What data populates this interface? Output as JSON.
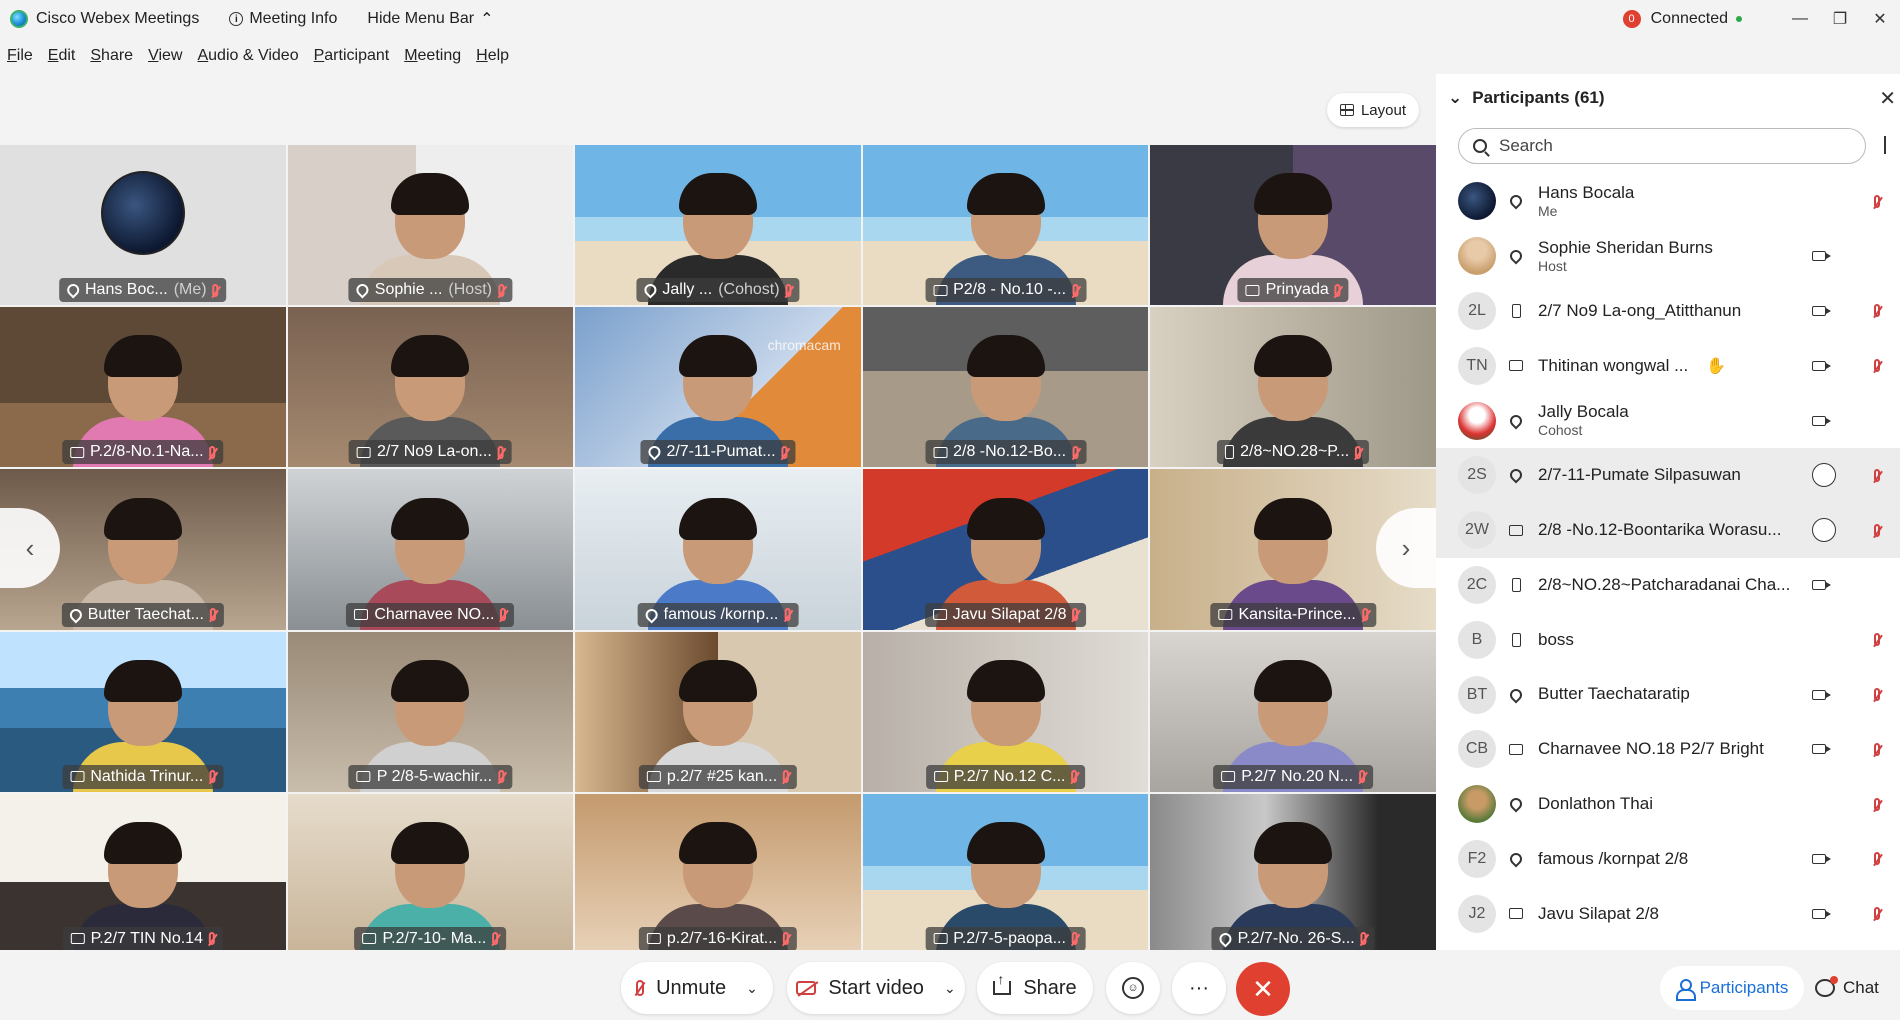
{
  "titlebar": {
    "app_name": "Cisco Webex Meetings",
    "meeting_info": "Meeting Info",
    "hide_menu": "Hide Menu Bar",
    "status": "Connected",
    "status_badge": "0"
  },
  "menu": [
    "File",
    "Edit",
    "Share",
    "View",
    "Audio & Video",
    "Participant",
    "Meeting",
    "Help"
  ],
  "layout_label": "Layout",
  "watermark": "chromacam",
  "tiles": [
    {
      "name": "Hans Boc...",
      "suffix": "(Me)",
      "icon": "audio"
    },
    {
      "name": "Sophie ...",
      "suffix": "(Host)",
      "icon": "audio"
    },
    {
      "name": "Jally ...",
      "suffix": "(Cohost)",
      "icon": "audio"
    },
    {
      "name": "P2/8 - No.10 -...",
      "suffix": "",
      "icon": "screen"
    },
    {
      "name": "Prinyada",
      "suffix": "",
      "icon": "screen"
    },
    {
      "name": "P.2/8-No.1-Na...",
      "suffix": "",
      "icon": "screen"
    },
    {
      "name": "2/7 No9 La-on...",
      "suffix": "",
      "icon": "screen"
    },
    {
      "name": "2/7-11-Pumat...",
      "suffix": "",
      "icon": "audio"
    },
    {
      "name": "2/8 -No.12-Bo...",
      "suffix": "",
      "icon": "screen"
    },
    {
      "name": "2/8~NO.28~P...",
      "suffix": "",
      "icon": "phone"
    },
    {
      "name": "Butter Taechat...",
      "suffix": "",
      "icon": "audio"
    },
    {
      "name": "Charnavee NO...",
      "suffix": "",
      "icon": "screen"
    },
    {
      "name": "famous /kornp...",
      "suffix": "",
      "icon": "audio"
    },
    {
      "name": "Javu Silapat 2/8",
      "suffix": "",
      "icon": "screen"
    },
    {
      "name": "Kansita-Prince...",
      "suffix": "",
      "icon": "screen"
    },
    {
      "name": "Nathida Trinur...",
      "suffix": "",
      "icon": "screen"
    },
    {
      "name": "P 2/8-5-wachir...",
      "suffix": "",
      "icon": "screen"
    },
    {
      "name": "p.2/7 #25 kan...",
      "suffix": "",
      "icon": "screen"
    },
    {
      "name": "P.2/7 No.12 C...",
      "suffix": "",
      "icon": "screen"
    },
    {
      "name": "P.2/7 No.20 N...",
      "suffix": "",
      "icon": "screen"
    },
    {
      "name": "P.2/7 TIN No.14",
      "suffix": "",
      "icon": "screen"
    },
    {
      "name": "P.2/7-10- Ma...",
      "suffix": "",
      "icon": "screen"
    },
    {
      "name": "p.2/7-16-Kirat...",
      "suffix": "",
      "icon": "screen"
    },
    {
      "name": "P.2/7-5-paopa...",
      "suffix": "",
      "icon": "screen"
    },
    {
      "name": "P.2/7-No. 26-S...",
      "suffix": "",
      "icon": "audio"
    }
  ],
  "panel": {
    "title": "Participants (61)",
    "search_placeholder": "Search",
    "participants": [
      {
        "initials": "",
        "name": "Hans Bocala",
        "role": "Me",
        "state": "audio"
      },
      {
        "initials": "",
        "name": "Sophie Sheridan Burns",
        "role": "Host",
        "state": "audio"
      },
      {
        "initials": "2L",
        "name": "2/7 No9 La-ong_Atitthanun",
        "role": "",
        "state": "phone"
      },
      {
        "initials": "TN",
        "name": "Thitinan wongwal ...",
        "role": "",
        "state": "screen"
      },
      {
        "initials": "",
        "name": "Jally Bocala",
        "role": "Cohost",
        "state": "audio"
      },
      {
        "initials": "2S",
        "name": "2/7-11-Pumate Silpasuwan",
        "role": "",
        "state": "audio"
      },
      {
        "initials": "2W",
        "name": "2/8 -No.12-Boontarika Worasu...",
        "role": "",
        "state": "screen"
      },
      {
        "initials": "2C",
        "name": "2/8~NO.28~Patcharadanai Cha...",
        "role": "",
        "state": "phone"
      },
      {
        "initials": "B",
        "name": "boss",
        "role": "",
        "state": "phone"
      },
      {
        "initials": "BT",
        "name": "Butter Taechataratip",
        "role": "",
        "state": "audio"
      },
      {
        "initials": "CB",
        "name": "Charnavee NO.18 P2/7 Bright",
        "role": "",
        "state": "screen"
      },
      {
        "initials": "",
        "name": "Donlathon Thai",
        "role": "",
        "state": "audio"
      },
      {
        "initials": "F2",
        "name": "famous /kornpat 2/8",
        "role": "",
        "state": "audio"
      },
      {
        "initials": "J2",
        "name": "Javu Silapat 2/8",
        "role": "",
        "state": "screen"
      }
    ]
  },
  "controls": {
    "unmute": "Unmute",
    "start_video": "Start video",
    "share": "Share",
    "more": "···",
    "end": "✕",
    "participants_tab": "Participants",
    "chat_tab": "Chat"
  },
  "colors": {
    "accent": "#1a6fd6",
    "danger": "#e0402f",
    "mute": "#d04040"
  }
}
